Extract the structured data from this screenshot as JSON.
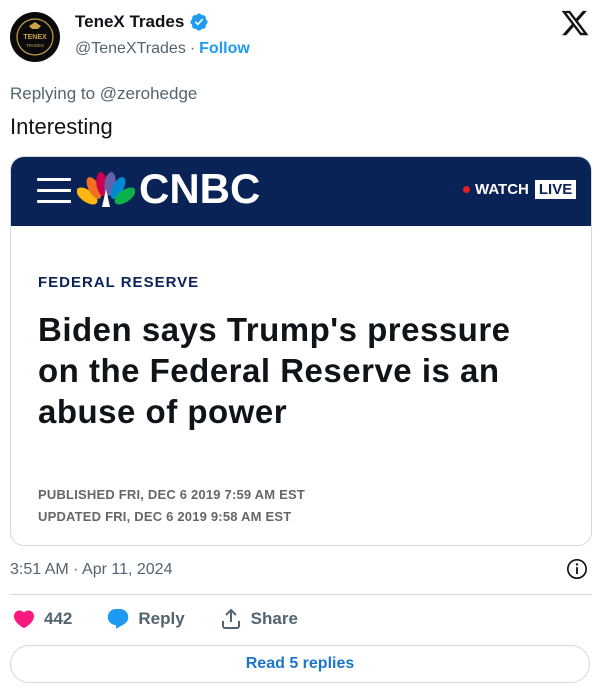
{
  "author": {
    "name": "TeneX Trades",
    "handle": "@TeneXTrades",
    "separator": "·",
    "follow_label": "Follow",
    "avatar_text_top": "TENEX",
    "avatar_text_bottom": "TRADES",
    "verified_color": "#1d9bf0"
  },
  "reply_to": "Replying to @zerohedge",
  "text": "Interesting",
  "card": {
    "brand": "CNBC",
    "watch_label": "WATCH",
    "live_label": "LIVE",
    "category": "FEDERAL RESERVE",
    "headline": "Biden says Trump's pressure on the Federal Reserve is an abuse of power",
    "published": "PUBLISHED FRI, DEC 6 2019 7:59 AM EST",
    "updated": "UPDATED FRI, DEC 6 2019 9:58 AM EST",
    "bar_color": "#0a2357"
  },
  "timestamp": "3:51 AM · Apr 11, 2024",
  "actions": {
    "like_count": "442",
    "reply_label": "Reply",
    "share_label": "Share"
  },
  "read_replies_label": "Read 5 replies",
  "colors": {
    "like": "#f91880",
    "reply": "#1d9bf0",
    "link": "#1d75c9"
  },
  "icons": [
    "verified-badge-icon",
    "x-logo-icon",
    "info-icon",
    "heart-icon",
    "reply-bubble-icon",
    "share-icon",
    "hamburger-menu-icon",
    "nbc-peacock-icon"
  ]
}
